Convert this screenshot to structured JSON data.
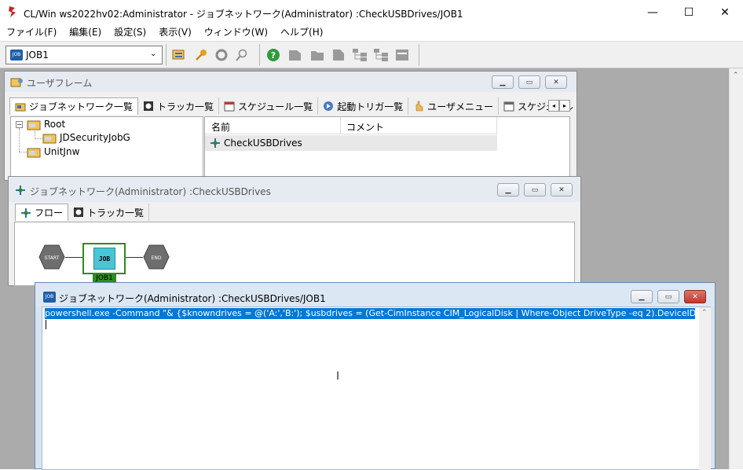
{
  "window": {
    "title": "CL/Win ws2022hv02:Administrator - ジョブネットワーク(Administrator) :CheckUSBDrives/JOB1",
    "minimize": "—",
    "maximize": "☐",
    "close": "✕"
  },
  "menubar": [
    "ファイル(F)",
    "編集(E)",
    "設定(S)",
    "表示(V)",
    "ウィンドウ(W)",
    "ヘルプ(H)"
  ],
  "toolbar": {
    "job_combo_value": "JOB1",
    "job_combo_icon_text": "JOB",
    "icons": [
      "list-icon",
      "key-icon",
      "refresh-icon",
      "zoom-icon",
      "help-icon",
      "doc-icon",
      "folder-icon",
      "doc2-icon",
      "tree-icon",
      "tree2-icon",
      "window-icon"
    ]
  },
  "user_frame": {
    "title": "ユーザフレーム",
    "tabs": [
      "ジョブネットワーク一覧",
      "トラッカ一覧",
      "スケジュール一覧",
      "起動トリガ一覧",
      "ユーザメニュー",
      "スケジュール"
    ],
    "tree": [
      "Root",
      "JDSecurityJobG",
      "UnitJnw"
    ],
    "list_headers": [
      "名前",
      "コメント"
    ],
    "list_rows": [
      {
        "name": "CheckUSBDrives",
        "comment": ""
      }
    ]
  },
  "jobnet_window": {
    "title": "ジョブネットワーク(Administrator) :CheckUSBDrives",
    "tabs": [
      "フロー",
      "トラッカ一覧"
    ],
    "flow": {
      "start": "START",
      "job": "JOB1",
      "job_icon": "JOB",
      "end": "END"
    }
  },
  "job_window": {
    "title": "ジョブネットワーク(Administrator) :CheckUSBDrives/JOB1",
    "icon_text": "JOB",
    "script_line": "powershell.exe -Command \"& {$knowndrives = @('A:','B:'); $usbdrives = (Get-CimInstance CIM_LogicalDisk | Where-Object DriveType -eq 2).DeviceID; if ($usbdriv"
  },
  "colors": {
    "selection": "#0078d7",
    "accent_green": "#2e8b1e",
    "close_red": "#c9463d"
  }
}
